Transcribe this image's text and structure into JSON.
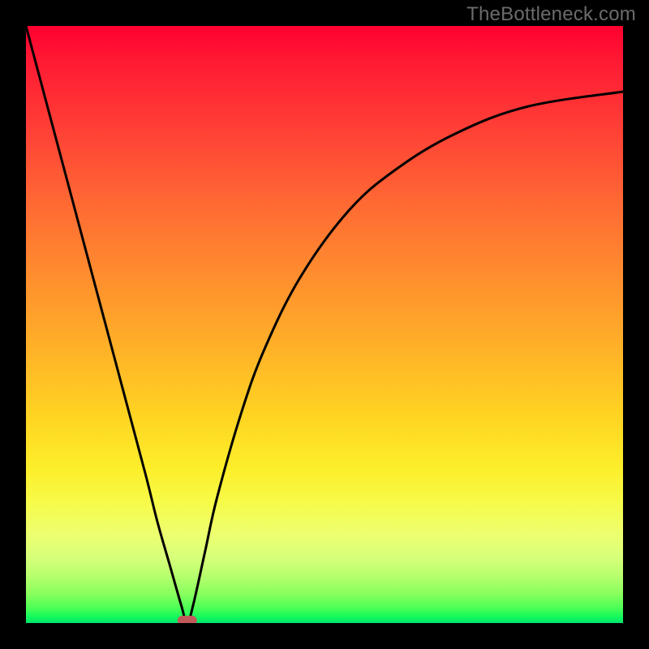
{
  "watermark": "TheBottleneck.com",
  "chart_data": {
    "type": "line",
    "title": "",
    "xlabel": "",
    "ylabel": "",
    "xlim": [
      0,
      100
    ],
    "ylim": [
      0,
      100
    ],
    "grid": false,
    "legend": false,
    "annotations": [],
    "background": {
      "gradient_stops": [
        {
          "pos": 0.0,
          "color": "#ff0030"
        },
        {
          "pos": 0.3,
          "color": "#ff6a33"
        },
        {
          "pos": 0.6,
          "color": "#ffc324"
        },
        {
          "pos": 0.82,
          "color": "#f2fe55"
        },
        {
          "pos": 0.95,
          "color": "#8bff5f"
        },
        {
          "pos": 1.0,
          "color": "#00e56a"
        }
      ]
    },
    "series": [
      {
        "name": "bottleneck-curve",
        "color": "#000000",
        "x": [
          0.0,
          4.0,
          8.0,
          12.0,
          16.0,
          20.0,
          22.0,
          24.0,
          26.0,
          27.0,
          28.0,
          30.0,
          32.0,
          36.0,
          40.0,
          46.0,
          54.0,
          62.0,
          72.0,
          84.0,
          100.0
        ],
        "y": [
          100.0,
          85.0,
          70.0,
          55.0,
          40.0,
          25.0,
          17.0,
          10.0,
          3.0,
          0.0,
          3.0,
          12.0,
          21.0,
          35.0,
          46.0,
          58.0,
          69.0,
          76.0,
          82.0,
          86.5,
          89.0
        ]
      }
    ],
    "marker": {
      "name": "min-point-marker",
      "x": 27.0,
      "y": 0.0,
      "shape": "pill",
      "color": "#c05a5a"
    }
  }
}
